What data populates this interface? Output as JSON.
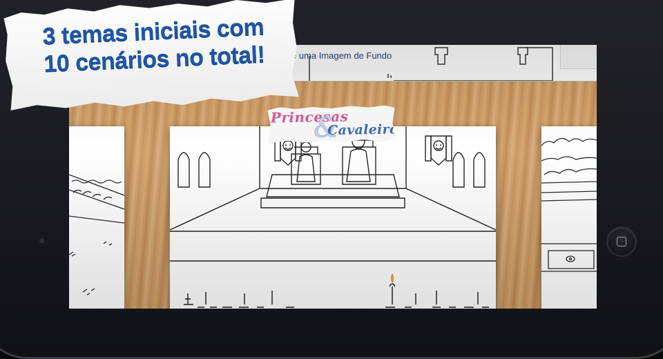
{
  "banner": {
    "line1": "3 temas iniciais com",
    "line2": "10 cenários no total!"
  },
  "toolbar": {
    "title": "e uma Imagem de Fundo"
  },
  "logo": {
    "line1": "Princesas",
    "ampersand": "&",
    "line2": "Cavaleiros"
  },
  "icons": {
    "home": "home-button-icon"
  },
  "colors": {
    "banner_text": "#1f56a6",
    "logo_pink": "#d6588f",
    "logo_blue": "#3f6ab4",
    "toolbar_text": "#1f3f7a"
  }
}
